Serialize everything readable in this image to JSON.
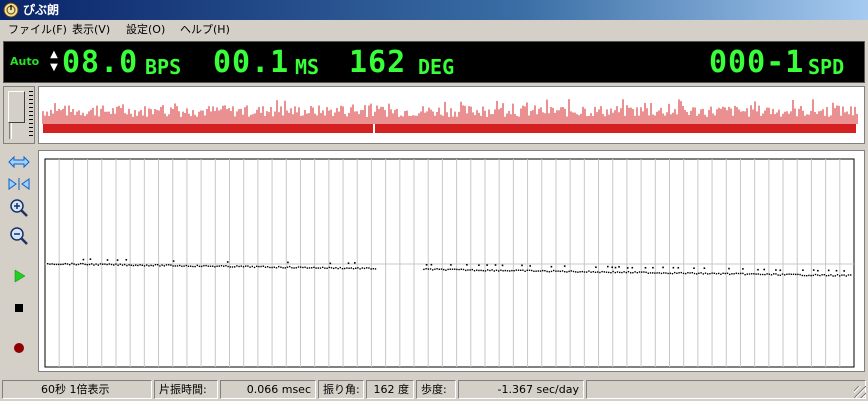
{
  "window": {
    "title": "ぴぶ朗"
  },
  "menu": {
    "items": [
      "ファイル(F)",
      "表示(V)",
      "設定(O)",
      "ヘルプ(H)"
    ]
  },
  "display": {
    "auto_label": "Auto",
    "spin_up": "▲",
    "spin_down": "▼",
    "bps_value": "08.0",
    "bps_unit": "BPS",
    "ms_value": "00.1",
    "ms_unit": "MS",
    "deg_value": "162",
    "deg_unit": "DEG",
    "spd_value": "000-1",
    "spd_unit": "SPD",
    "digit_color": "#39ff3a",
    "auto_color": "#28e028"
  },
  "waveform": {
    "bar_color": "#d42020",
    "baseline_color": "#d42020",
    "marker_color": "#ffffff",
    "marker_position": 0.405
  },
  "toolbar": {
    "buttons": [
      {
        "icon": "fit-horizontal-icon",
        "label": ""
      },
      {
        "icon": "shrink-icon",
        "label": ""
      },
      {
        "icon": "zoom-in-icon",
        "label": ""
      },
      {
        "icon": "zoom-out-icon",
        "label": ""
      },
      {
        "icon": "play-icon",
        "label": ""
      },
      {
        "icon": "stop-icon",
        "label": ""
      },
      {
        "icon": "record-icon",
        "label": ""
      }
    ]
  },
  "plot": {
    "point_color": "#000000",
    "grid_color": "#c8c8c8",
    "gap_fraction_start": 0.41,
    "gap_fraction_end": 0.465
  },
  "status": {
    "view_mode": "60秒 1倍表示",
    "amplitude_time_label": "片振時間:",
    "amplitude_time_value": "0.066 msec",
    "swing_angle_label": "振り角:",
    "swing_angle_value": "162 度",
    "rate_label": "歩度:",
    "rate_value": "-1.367 sec/day"
  }
}
